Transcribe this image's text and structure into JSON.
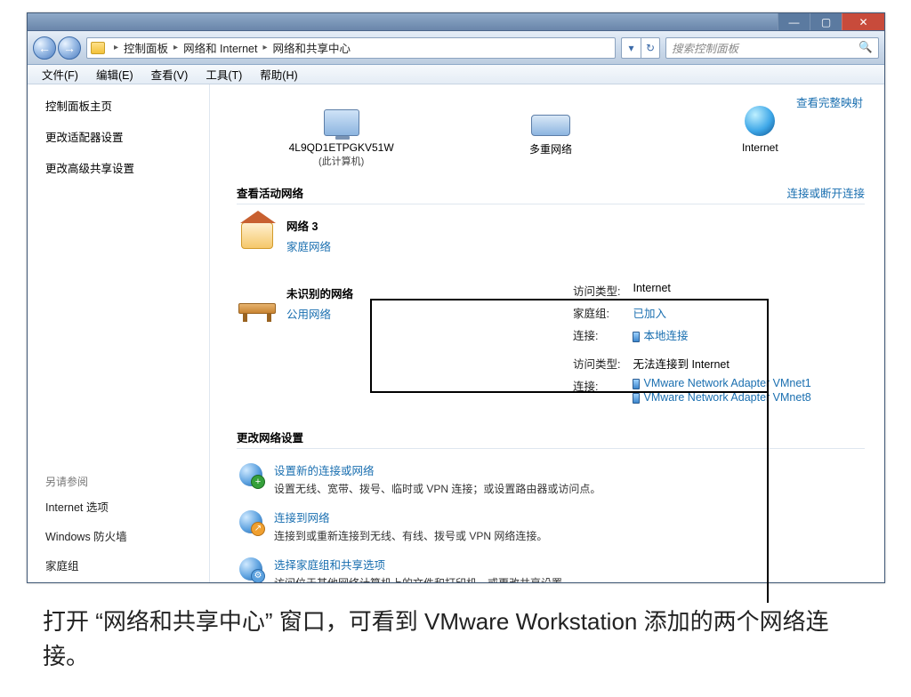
{
  "titlebar": {
    "min": "—",
    "max": "▢",
    "close": "✕"
  },
  "address": {
    "root_icon": "folder",
    "crumb1": "控制面板",
    "crumb2": "网络和 Internet",
    "crumb3": "网络和共享中心"
  },
  "navbuttons": {
    "back": "←",
    "fwd": "→"
  },
  "search": {
    "placeholder": "搜索控制面板",
    "icon": "🔍"
  },
  "menubar": [
    "文件(F)",
    "编辑(E)",
    "查看(V)",
    "工具(T)",
    "帮助(H)"
  ],
  "sidebar": {
    "top": [
      "控制面板主页",
      "更改适配器设置",
      "更改高级共享设置"
    ],
    "see_title": "另请参阅",
    "see": [
      "Internet 选项",
      "Windows 防火墙",
      "家庭组"
    ]
  },
  "map": {
    "full_map_link": "查看完整映射",
    "nodes": [
      {
        "name": "4L9QD1ETPGKV51W",
        "sub": "(此计算机)"
      },
      {
        "name": "多重网络",
        "sub": ""
      },
      {
        "name": "Internet",
        "sub": ""
      }
    ]
  },
  "active": {
    "title": "查看活动网络",
    "right_link": "连接或断开连接",
    "n1": {
      "name": "网络 3",
      "type": "家庭网络"
    },
    "n2": {
      "name": "未识别的网络",
      "type": "公用网络"
    }
  },
  "details1": {
    "access_lab": "访问类型:",
    "access_val": "Internet",
    "hg_lab": "家庭组:",
    "hg_val": "已加入",
    "conn_lab": "连接:",
    "conn_val": "本地连接"
  },
  "details2": {
    "access_lab": "访问类型:",
    "access_val": "无法连接到 Internet",
    "conn_lab": "连接:",
    "adapters": [
      "VMware Network Adapter VMnet1",
      "VMware Network Adapter VMnet8"
    ]
  },
  "settings": {
    "title": "更改网络设置",
    "items": [
      {
        "t": "设置新的连接或网络",
        "d": "设置无线、宽带、拨号、临时或 VPN 连接；或设置路由器或访问点。"
      },
      {
        "t": "连接到网络",
        "d": "连接到或重新连接到无线、有线、拨号或 VPN 网络连接。"
      },
      {
        "t": "选择家庭组和共享选项",
        "d": "访问位于其他网络计算机上的文件和打印机，或更改共享设置。"
      }
    ]
  },
  "caption": "打开 “网络和共享中心” 窗口，可看到 VMware Workstation 添加的两个网络连接。"
}
